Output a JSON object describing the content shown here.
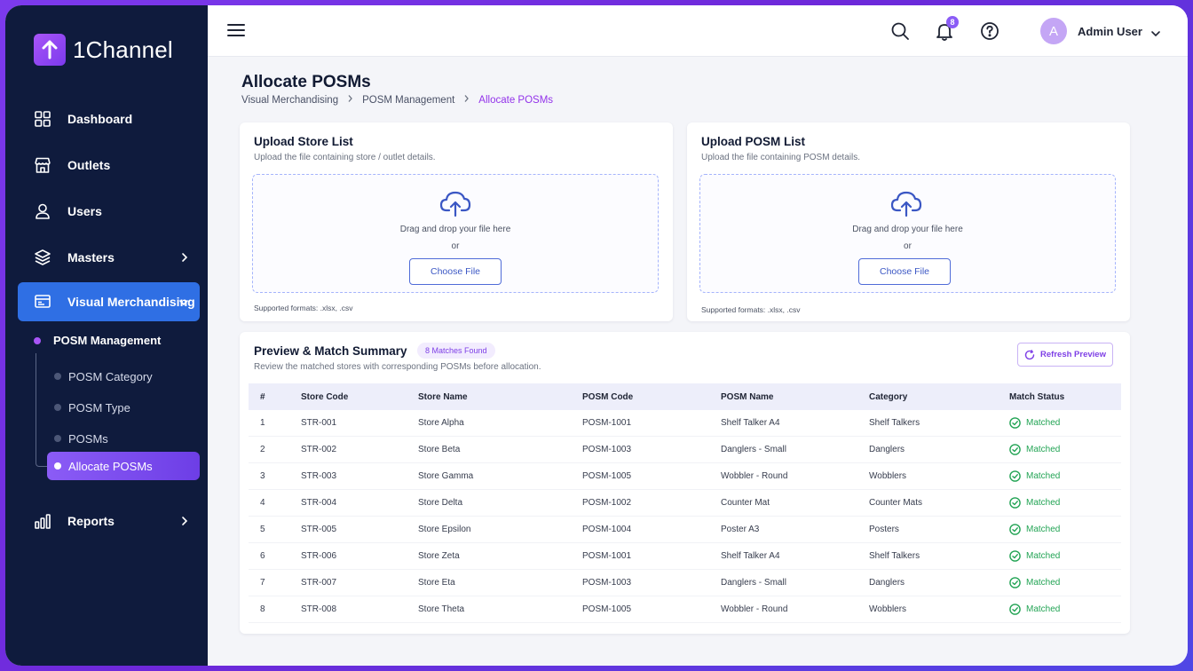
{
  "app": {
    "brand": "1Channel"
  },
  "sidebar": {
    "items": [
      {
        "label": "Dashboard",
        "icon": "grid-icon"
      },
      {
        "label": "Outlets",
        "icon": "store-icon"
      },
      {
        "label": "Users",
        "icon": "user-icon"
      },
      {
        "label": "Masters",
        "icon": "layers-icon"
      },
      {
        "label": "Visual Merchandising",
        "icon": "monitor-icon"
      },
      {
        "label": "Reports",
        "icon": "bar-chart-icon"
      }
    ],
    "sub_parent": "POSM Management",
    "sub_items": [
      "POSM Category",
      "POSM Type",
      "POSMs",
      "Allocate POSMs"
    ]
  },
  "topbar": {
    "notification_count": "8",
    "avatar_initial": "A",
    "user_name": "Admin User"
  },
  "page": {
    "title": "Allocate POSMs",
    "breadcrumb": [
      "Visual Merchandising",
      "POSM Management",
      "Allocate POSMs"
    ]
  },
  "upload_store": {
    "title": "Upload Store List",
    "subtitle": "Upload the file containing store / outlet details.",
    "drag_text": "Drag and drop your file here",
    "or_text": "or",
    "button": "Choose File",
    "formats": "Supported formats: .xlsx, .csv"
  },
  "upload_posm": {
    "title": "Upload POSM List",
    "subtitle": "Upload the file containing POSM details.",
    "drag_text": "Drag and drop your file here",
    "or_text": "or",
    "button": "Choose File",
    "formats": "Supported formats: .xlsx, .csv"
  },
  "summary": {
    "title": "Preview & Match Summary",
    "badge": "8 Matches Found",
    "subtitle": "Review the matched stores with corresponding POSMs before allocation.",
    "refresh_label": "Refresh Preview",
    "columns": [
      "#",
      "Store Code",
      "Store Name",
      "POSM Code",
      "POSM Name",
      "Category",
      "Match Status"
    ],
    "rows": [
      [
        "1",
        "STR-001",
        "Store Alpha",
        "POSM-1001",
        "Shelf Talker A4",
        "Shelf Talkers",
        "Matched"
      ],
      [
        "2",
        "STR-002",
        "Store Beta",
        "POSM-1003",
        "Danglers - Small",
        "Danglers",
        "Matched"
      ],
      [
        "3",
        "STR-003",
        "Store Gamma",
        "POSM-1005",
        "Wobbler - Round",
        "Wobblers",
        "Matched"
      ],
      [
        "4",
        "STR-004",
        "Store Delta",
        "POSM-1002",
        "Counter Mat",
        "Counter Mats",
        "Matched"
      ],
      [
        "5",
        "STR-005",
        "Store Epsilon",
        "POSM-1004",
        "Poster A3",
        "Posters",
        "Matched"
      ],
      [
        "6",
        "STR-006",
        "Store Zeta",
        "POSM-1001",
        "Shelf Talker A4",
        "Shelf Talkers",
        "Matched"
      ],
      [
        "7",
        "STR-007",
        "Store Eta",
        "POSM-1003",
        "Danglers - Small",
        "Danglers",
        "Matched"
      ],
      [
        "8",
        "STR-008",
        "Store Theta",
        "POSM-1005",
        "Wobbler - Round",
        "Wobblers",
        "Matched"
      ]
    ]
  },
  "colors": {
    "sidebar_bg": "#0f1b3d",
    "active_nav": "#2f6fe4",
    "accent_purple": "#8b5cf6",
    "matched_green": "#23a455"
  }
}
